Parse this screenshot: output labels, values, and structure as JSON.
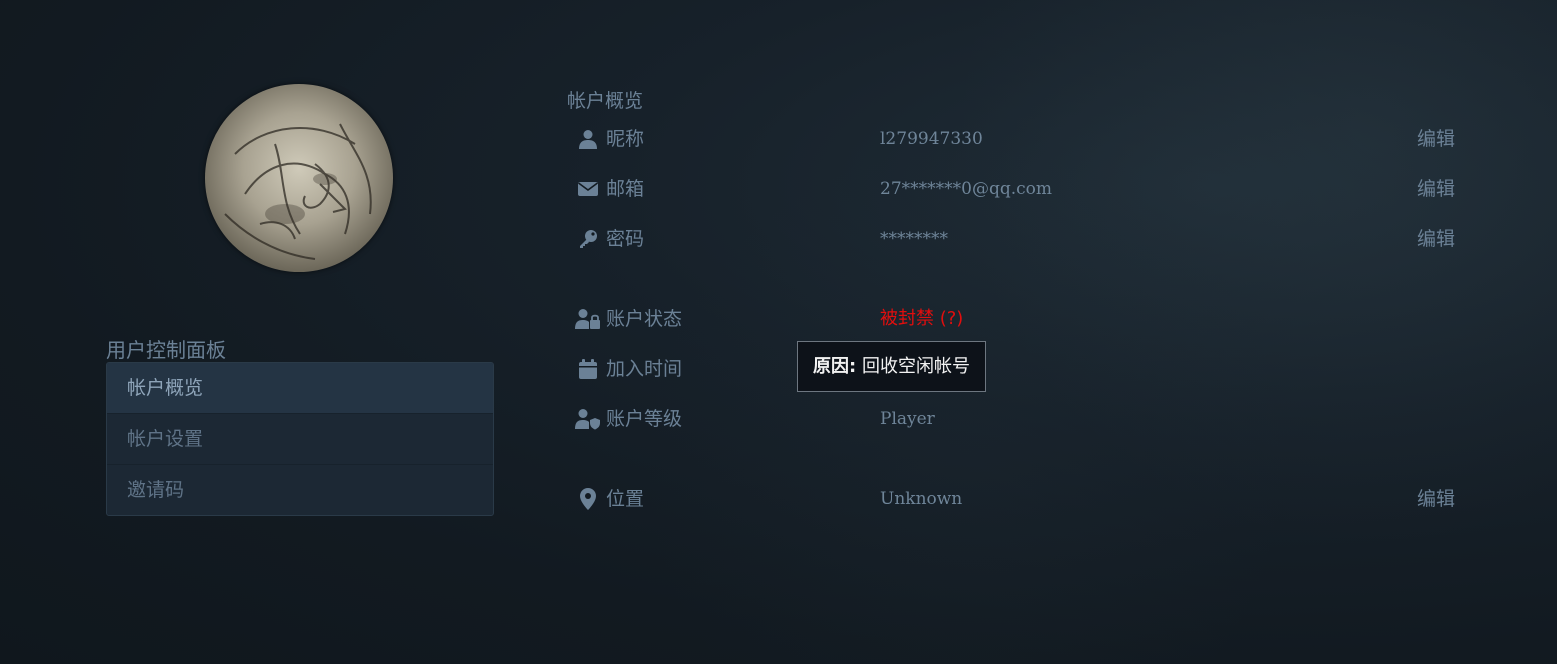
{
  "sidebar": {
    "avatar_alt": "avatar",
    "title": "用户控制面板",
    "items": [
      {
        "label": "帐户概览",
        "active": true
      },
      {
        "label": "帐户设置",
        "active": false
      },
      {
        "label": "邀请码",
        "active": false
      }
    ]
  },
  "overview": {
    "title": "帐户概览",
    "rows": {
      "nickname": {
        "label": "昵称",
        "value": "l279947330",
        "edit": "编辑",
        "icon": "user-icon"
      },
      "email": {
        "label": "邮箱",
        "value": "27*******0@qq.com",
        "edit": "编辑",
        "icon": "envelope-icon"
      },
      "password": {
        "label": "密码",
        "value": "********",
        "edit": "编辑",
        "icon": "key-icon"
      },
      "status": {
        "label": "账户状态",
        "value": "被封禁 (?)",
        "icon": "user-lock-icon"
      },
      "join_time": {
        "label": "加入时间",
        "value": "",
        "icon": "calendar-icon"
      },
      "level": {
        "label": "账户等级",
        "value": "Player",
        "icon": "user-shield-icon"
      },
      "location": {
        "label": "位置",
        "value": "Unknown",
        "edit": "编辑",
        "icon": "map-marker-icon"
      }
    }
  },
  "tooltip": {
    "label": "原因:",
    "text": "回收空闲帐号"
  },
  "colors": {
    "banned": "#e10e0e",
    "text": "#6b8196",
    "background": "#121a21"
  }
}
